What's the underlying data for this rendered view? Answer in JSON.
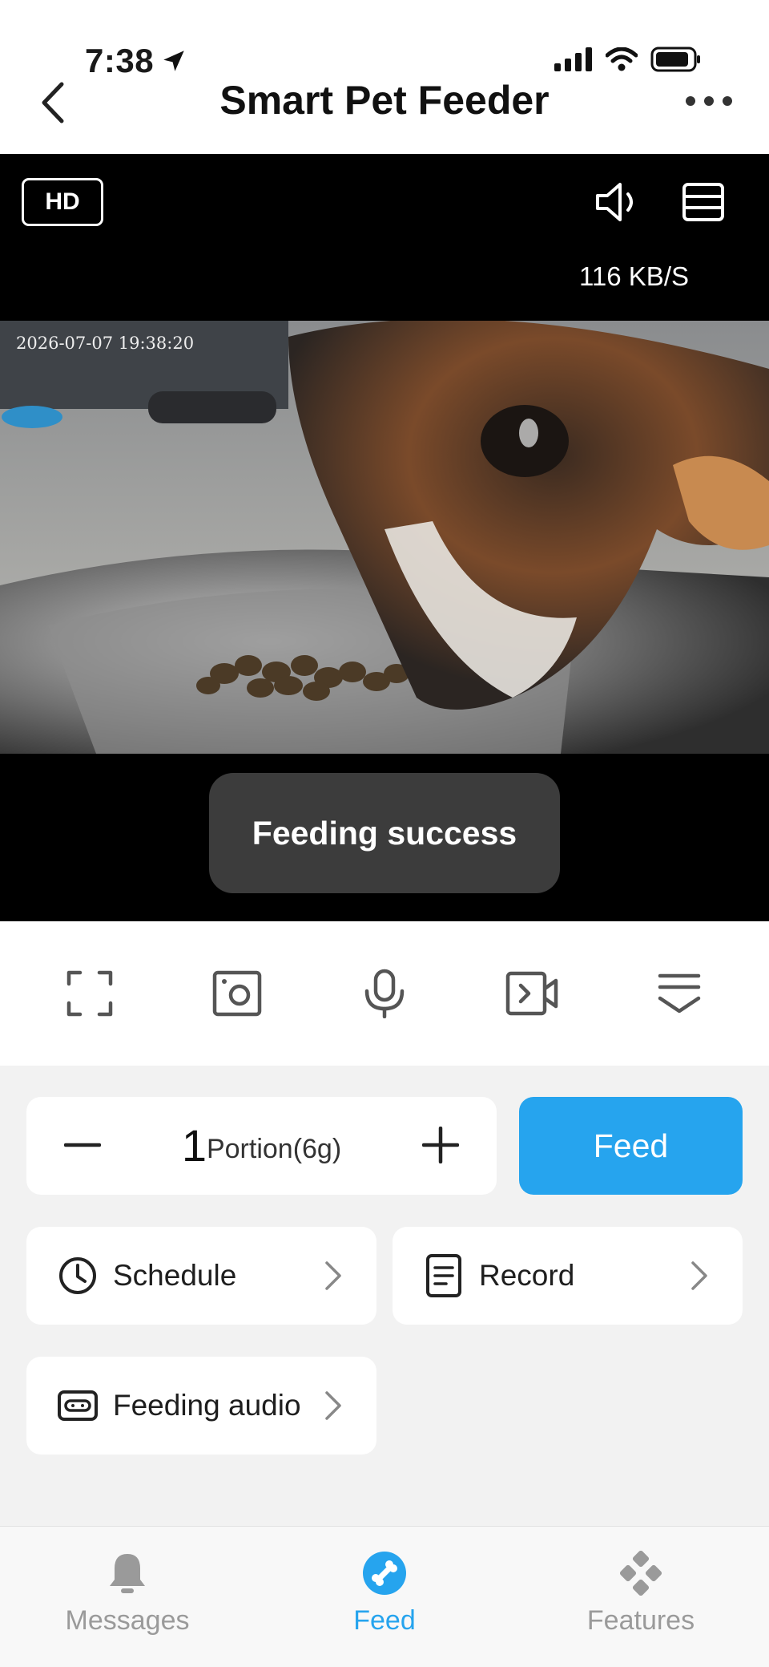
{
  "status_bar": {
    "time": "7:38"
  },
  "header": {
    "title": "Smart Pet Feeder"
  },
  "video": {
    "quality_label": "HD",
    "speed": "116 KB/S",
    "timestamp": "2026-07-07 19:38:20",
    "toast": "Feeding success"
  },
  "toolbar": {
    "icons": [
      "fullscreen-icon",
      "snapshot-icon",
      "microphone-icon",
      "record-video-icon",
      "collapse-icon"
    ]
  },
  "feed": {
    "portion_count": "1",
    "portion_unit": "Portion(6g)",
    "feed_label": "Feed"
  },
  "cards": {
    "schedule": "Schedule",
    "record": "Record",
    "feeding_audio": "Feeding audio"
  },
  "tabs": [
    {
      "label": "Messages",
      "active": false
    },
    {
      "label": "Feed",
      "active": true
    },
    {
      "label": "Features",
      "active": false
    }
  ],
  "colors": {
    "accent": "#26a4ee",
    "toast_bg": "#3c3c3c",
    "video_bg": "#000000"
  }
}
